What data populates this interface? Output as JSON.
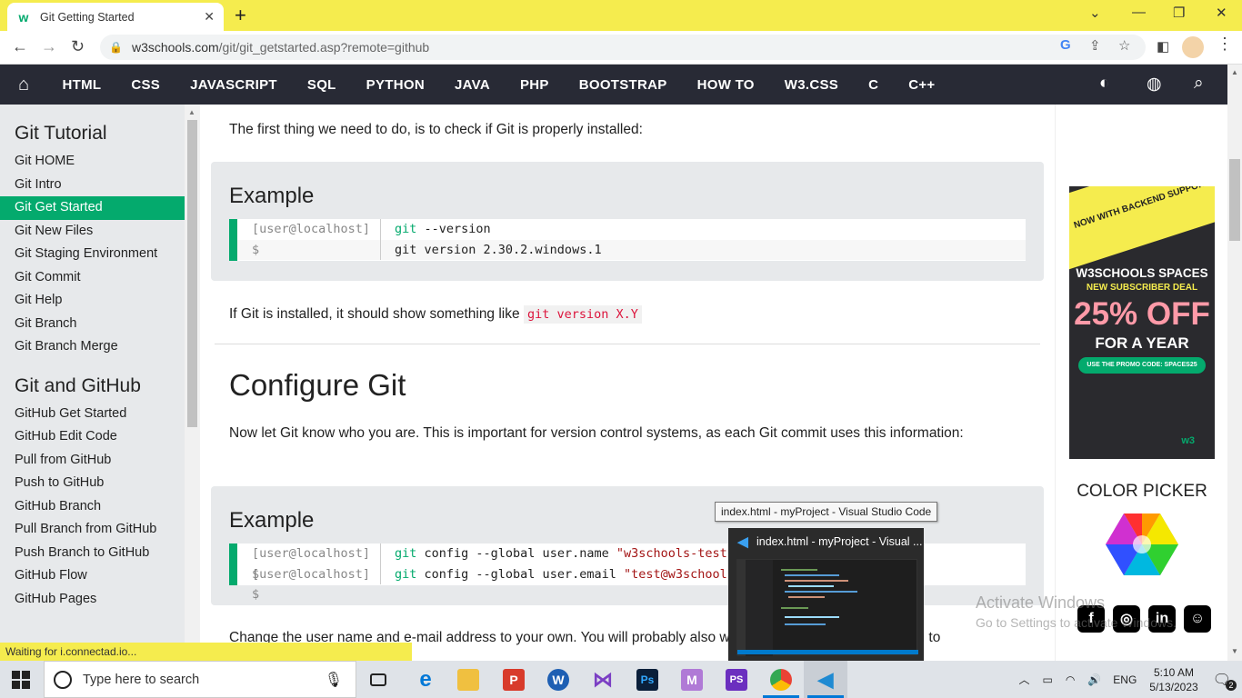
{
  "browser": {
    "tab_title": "Git Getting Started",
    "url_host": "w3schools.com",
    "url_path": "/git/git_getstarted.asp?remote=github"
  },
  "nav": {
    "items": [
      "HTML",
      "CSS",
      "JAVASCRIPT",
      "SQL",
      "PYTHON",
      "JAVA",
      "PHP",
      "BOOTSTRAP",
      "HOW TO",
      "W3.CSS",
      "C",
      "C++"
    ]
  },
  "sidebar": {
    "section1_title": "Git Tutorial",
    "section1_items": [
      "Git HOME",
      "Git Intro",
      "Git Get Started",
      "Git New Files",
      "Git Staging Environment",
      "Git Commit",
      "Git Help",
      "Git Branch",
      "Git Branch Merge"
    ],
    "active_item": "Git Get Started",
    "section2_title": "Git and GitHub",
    "section2_items": [
      "GitHub Get Started",
      "GitHub Edit Code",
      "Pull from GitHub",
      "Push to GitHub",
      "GitHub Branch",
      "Pull Branch from GitHub",
      "Push Branch to GitHub",
      "GitHub Flow",
      "GitHub Pages"
    ]
  },
  "main": {
    "intro": "The first thing we need to do, is to check if Git is properly installed:",
    "example1": {
      "title": "Example",
      "rows": [
        {
          "prompt": "[user@localhost] $",
          "kw": "git",
          "rest": " --version"
        },
        {
          "prompt": "",
          "kw": "",
          "rest": "git version 2.30.2.windows.1"
        }
      ]
    },
    "installed_text": "If Git is installed, it should show something like",
    "installed_code": "git version X.Y",
    "configure_heading": "Configure Git",
    "configure_text": "Now let Git know who you are. This is important for version control systems, as each Git commit uses this information:",
    "example2": {
      "title": "Example",
      "rows": [
        {
          "prompt": "[user@localhost] $",
          "kw": "git",
          "rest": " config --global user.name ",
          "str": "\"w3schools-test\""
        },
        {
          "prompt": "[user@localhost] $",
          "kw": "git",
          "rest": " config --global user.email ",
          "str": "\"test@w3schools.com\""
        }
      ]
    },
    "change_text": "Change the user name and e-mail address to your own. You will probably also want to use this when registering to"
  },
  "ad": {
    "banner": "NOW WITH BACKEND SUPPORT",
    "line1": "W3SCHOOLS SPACES",
    "line2": "NEW SUBSCRIBER DEAL",
    "line3": "25% OFF",
    "line4": "FOR A YEAR",
    "promo": "USE THE PROMO CODE: SPACES25",
    "logo": "w3"
  },
  "right": {
    "color_picker": "COLOR PICKER"
  },
  "status_text": "Waiting for i.connectad.io...",
  "tooltip": "index.html - myProject - Visual Studio Code",
  "thumbnail_title": "index.html - myProject - Visual ...",
  "watermark": {
    "line1": "Activate Windows",
    "line2": "Go to Settings to activate Windows."
  },
  "taskbar": {
    "search_placeholder": "Type here to search",
    "lang": "ENG",
    "time": "5:10 AM",
    "date": "5/13/2023",
    "notification_count": "2"
  },
  "colors": {
    "accent": "#04aa6d",
    "nav_bg": "#282a35",
    "tab_strip": "#f5ec4e"
  }
}
